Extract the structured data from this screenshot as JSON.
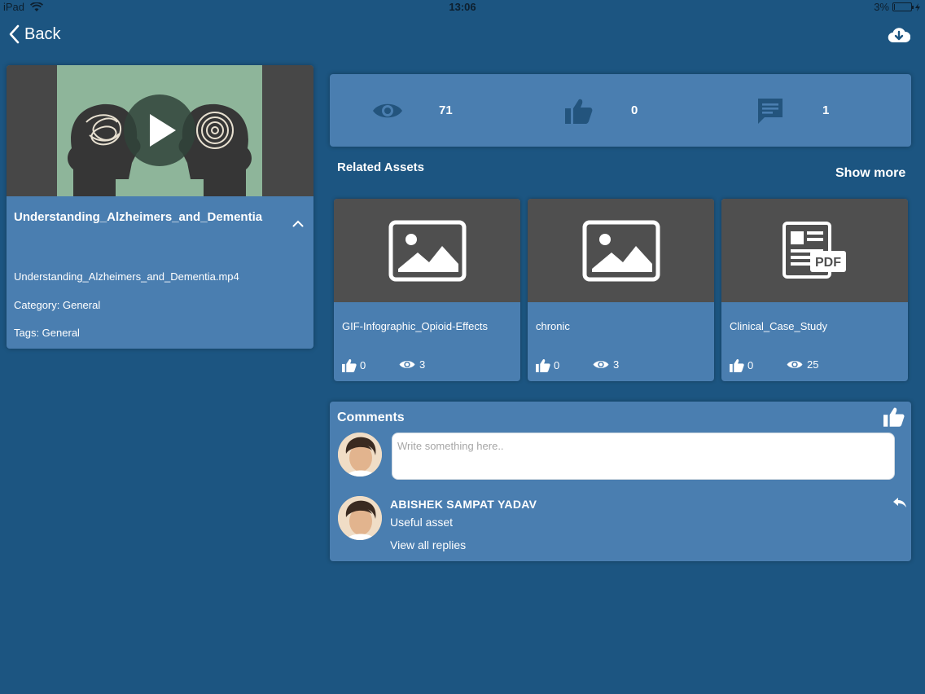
{
  "status_bar": {
    "device": "iPad",
    "time": "13:06",
    "battery": "3%"
  },
  "nav": {
    "back_label": "Back"
  },
  "video": {
    "title": "Understanding_Alzheimers_and_Dementia",
    "filename": "Understanding_Alzheimers_and_Dementia.mp4",
    "category": "Category: General",
    "tags": "Tags: General"
  },
  "stats": {
    "views": "71",
    "likes": "0",
    "comments": "1"
  },
  "related": {
    "title": "Related Assets",
    "show_more": "Show more",
    "items": [
      {
        "name": "GIF-Infographic_Opioid-Effects",
        "likes": "0",
        "views": "3",
        "thumb_icon": "image-icon"
      },
      {
        "name": "chronic",
        "likes": "0",
        "views": "3",
        "thumb_icon": "image-icon"
      },
      {
        "name": "Clinical_Case_Study",
        "likes": "0",
        "views": "25",
        "thumb_icon": "pdf-icon",
        "badge": "PDF"
      }
    ]
  },
  "comments": {
    "title": "Comments",
    "placeholder": "Write something here..",
    "items": [
      {
        "author": "ABISHEK SAMPAT YADAV",
        "text": "Useful asset",
        "view_replies": "View all replies"
      }
    ]
  },
  "colors": {
    "background": "#1c5581",
    "card": "#4a7eb0",
    "thumb": "#4f4f4f",
    "text": "#ffffff"
  }
}
